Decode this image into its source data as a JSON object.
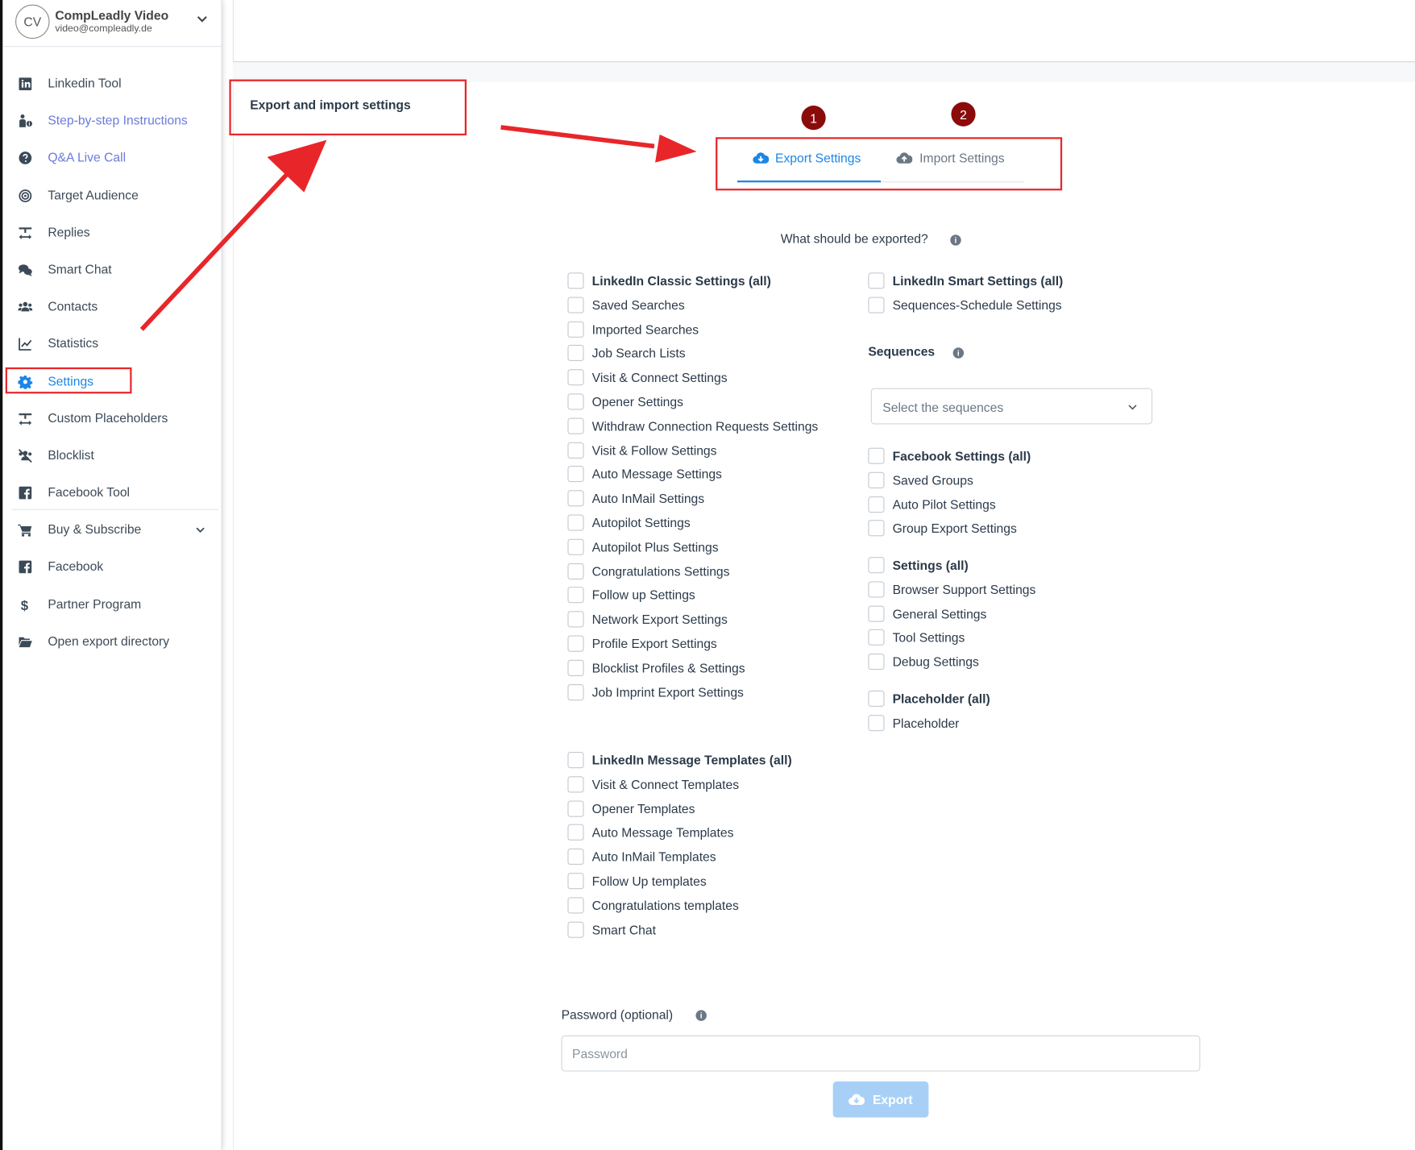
{
  "account": {
    "initials": "CV",
    "name": "CompLeadly Video",
    "email": "video@compleadly.de"
  },
  "sidebar": {
    "items": [
      {
        "label": "Linkedin Tool",
        "icon": "linkedin-icon"
      },
      {
        "label": "Step-by-step Instructions",
        "icon": "person-info-icon"
      },
      {
        "label": "Q&A Live Call",
        "icon": "question-circle-icon"
      },
      {
        "label": "Target Audience",
        "icon": "target-icon"
      },
      {
        "label": "Replies",
        "icon": "reply-icon"
      },
      {
        "label": "Smart Chat",
        "icon": "chat-bubbles-icon"
      },
      {
        "label": "Contacts",
        "icon": "users-icon"
      },
      {
        "label": "Statistics",
        "icon": "line-chart-icon"
      },
      {
        "label": "Settings",
        "icon": "gear-icon"
      },
      {
        "label": "Custom Placeholders",
        "icon": "placeholder-icon"
      },
      {
        "label": "Blocklist",
        "icon": "blocked-users-icon"
      },
      {
        "label": "Facebook Tool",
        "icon": "facebook-icon"
      },
      {
        "label": "Buy & Subscribe",
        "icon": "cart-icon"
      },
      {
        "label": "Facebook",
        "icon": "facebook-icon"
      },
      {
        "label": "Partner Program",
        "icon": "dollar-icon"
      },
      {
        "label": "Open export directory",
        "icon": "folder-open-icon"
      }
    ]
  },
  "page": {
    "breadcrumb": "Export and import settings"
  },
  "tabs": [
    {
      "label": "Export Settings",
      "badge": "1",
      "icon": "cloud-download-icon"
    },
    {
      "label": "Import Settings",
      "badge": "2",
      "icon": "cloud-upload-icon"
    }
  ],
  "export": {
    "question": "What should be exported?",
    "linkedin_classic": {
      "head": "LinkedIn Classic Settings (all)",
      "items": [
        "Saved Searches",
        "Imported Searches",
        "Job Search Lists",
        "Visit & Connect Settings",
        "Opener Settings",
        "Withdraw Connection Requests Settings",
        "Visit & Follow Settings",
        "Auto Message Settings",
        "Auto InMail Settings",
        "Autopilot Settings",
        "Autopilot Plus Settings",
        "Congratulations Settings",
        "Follow up Settings",
        "Network Export Settings",
        "Profile Export Settings",
        "Blocklist Profiles & Settings",
        "Job Imprint Export Settings"
      ]
    },
    "message_templates": {
      "head": "LinkedIn Message Templates (all)",
      "items": [
        "Visit & Connect Templates",
        "Opener Templates",
        "Auto Message Templates",
        "Auto InMail Templates",
        "Follow Up templates",
        "Congratulations templates",
        "Smart Chat"
      ]
    },
    "linkedin_smart": {
      "head": "LinkedIn Smart Settings (all)",
      "items": [
        "Sequences-Schedule Settings"
      ]
    },
    "sequences": {
      "label": "Sequences",
      "placeholder": "Select the sequences"
    },
    "facebook": {
      "head": "Facebook Settings (all)",
      "items": [
        "Saved Groups",
        "Auto Pilot Settings",
        "Group Export Settings"
      ]
    },
    "settings_group": {
      "head": "Settings (all)",
      "items": [
        "Browser Support Settings",
        "General Settings",
        "Tool Settings",
        "Debug Settings"
      ]
    },
    "placeholder_group": {
      "head": "Placeholder (all)",
      "items": [
        "Placeholder"
      ]
    },
    "password": {
      "label": "Password (optional)",
      "placeholder": "Password"
    },
    "button": {
      "label": "Export"
    }
  },
  "colors": {
    "accent": "#1b86e8",
    "annotation": "#e8262a",
    "badge": "#8b0b0b",
    "button_disabled": "#a8d0f7"
  }
}
